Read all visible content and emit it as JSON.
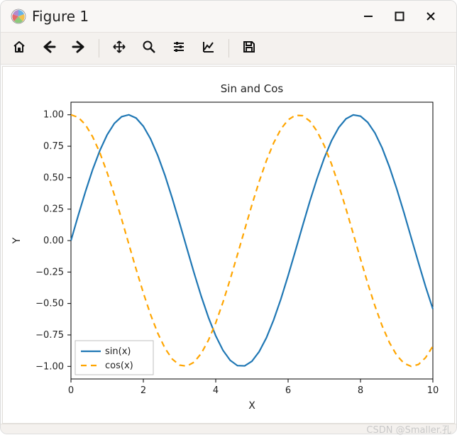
{
  "window": {
    "title": "Figure 1",
    "controls": {
      "minimize": "−",
      "maximize": "□",
      "close": "✕"
    }
  },
  "toolbar": {
    "home": {
      "tip": "Home"
    },
    "back": {
      "tip": "Back"
    },
    "fwd": {
      "tip": "Forward"
    },
    "pan": {
      "tip": "Pan"
    },
    "zoom": {
      "tip": "Zoom"
    },
    "config": {
      "tip": "Configure subplots"
    },
    "edit": {
      "tip": "Edit axis"
    },
    "save": {
      "tip": "Save"
    }
  },
  "watermark": "CSDN @Smaller.孔",
  "chart_data": {
    "type": "line",
    "title": "Sin and Cos",
    "xlabel": "X",
    "ylabel": "Y",
    "xlim": [
      0,
      10
    ],
    "ylim": [
      -1.1,
      1.1
    ],
    "xticks": [
      0,
      2,
      4,
      6,
      8,
      10
    ],
    "yticks": [
      -1.0,
      -0.75,
      -0.5,
      -0.25,
      0.0,
      0.25,
      0.5,
      0.75,
      1.0
    ],
    "ytick_labels": [
      "−1.00",
      "−0.75",
      "−0.50",
      "−0.25",
      "0.00",
      "0.25",
      "0.50",
      "0.75",
      "1.00"
    ],
    "legend": {
      "position": "lower left",
      "items": [
        "sin(x)",
        "cos(x)"
      ]
    },
    "series": [
      {
        "name": "sin(x)",
        "style": "solid",
        "color": "#1f77b4",
        "x": [
          0,
          0.2,
          0.4,
          0.6,
          0.8,
          1,
          1.2,
          1.4,
          1.6,
          1.8,
          2,
          2.2,
          2.4,
          2.6,
          2.8,
          3,
          3.2,
          3.4,
          3.6,
          3.8,
          4,
          4.2,
          4.4,
          4.6,
          4.8,
          5,
          5.2,
          5.4,
          5.6,
          5.8,
          6,
          6.2,
          6.4,
          6.6,
          6.8,
          7,
          7.2,
          7.4,
          7.6,
          7.8,
          8,
          8.2,
          8.4,
          8.6,
          8.8,
          9,
          9.2,
          9.4,
          9.6,
          9.8,
          10
        ],
        "y": [
          0.0,
          0.199,
          0.389,
          0.565,
          0.717,
          0.841,
          0.932,
          0.985,
          1.0,
          0.974,
          0.909,
          0.808,
          0.675,
          0.516,
          0.335,
          0.141,
          -0.058,
          -0.256,
          -0.443,
          -0.612,
          -0.757,
          -0.872,
          -0.952,
          -0.994,
          -0.996,
          -0.959,
          -0.883,
          -0.773,
          -0.631,
          -0.465,
          -0.279,
          -0.083,
          0.117,
          0.312,
          0.494,
          0.657,
          0.794,
          0.899,
          0.968,
          0.999,
          0.989,
          0.94,
          0.855,
          0.735,
          0.585,
          0.412,
          0.223,
          0.024,
          -0.174,
          -0.367,
          -0.544
        ]
      },
      {
        "name": "cos(x)",
        "style": "dashed",
        "color": "#ffa500",
        "x": [
          0,
          0.2,
          0.4,
          0.6,
          0.8,
          1,
          1.2,
          1.4,
          1.6,
          1.8,
          2,
          2.2,
          2.4,
          2.6,
          2.8,
          3,
          3.2,
          3.4,
          3.6,
          3.8,
          4,
          4.2,
          4.4,
          4.6,
          4.8,
          5,
          5.2,
          5.4,
          5.6,
          5.8,
          6,
          6.2,
          6.4,
          6.6,
          6.8,
          7,
          7.2,
          7.4,
          7.6,
          7.8,
          8,
          8.2,
          8.4,
          8.6,
          8.8,
          9,
          9.2,
          9.4,
          9.6,
          9.8,
          10
        ],
        "y": [
          1.0,
          0.98,
          0.921,
          0.825,
          0.697,
          0.54,
          0.362,
          0.17,
          -0.029,
          -0.227,
          -0.416,
          -0.589,
          -0.737,
          -0.857,
          -0.942,
          -0.99,
          -0.998,
          -0.967,
          -0.897,
          -0.791,
          -0.654,
          -0.49,
          -0.307,
          -0.112,
          0.087,
          0.284,
          0.469,
          0.635,
          0.776,
          0.886,
          0.96,
          0.996,
          0.993,
          0.95,
          0.869,
          0.754,
          0.608,
          0.439,
          0.252,
          0.054,
          -0.146,
          -0.34,
          -0.52,
          -0.679,
          -0.811,
          -0.911,
          -0.975,
          -1.0,
          -0.985,
          -0.93,
          -0.839
        ]
      }
    ]
  }
}
